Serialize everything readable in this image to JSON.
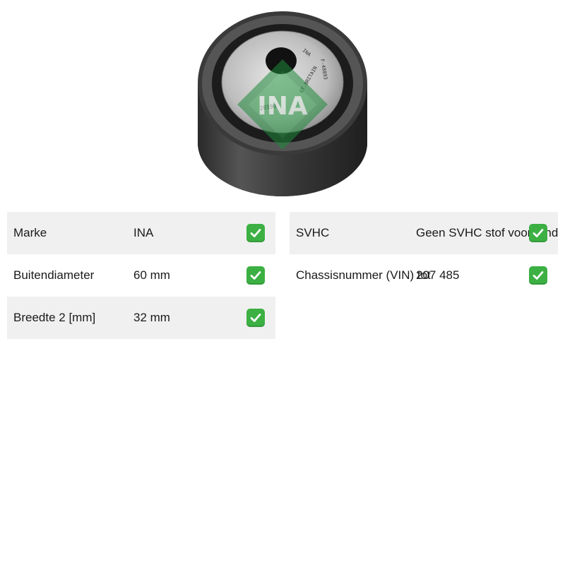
{
  "product": {
    "image_alt": "INA idler pulley",
    "image_markings": [
      "INA",
      "F-48893",
      "GT.BRITAIN",
      "20190"
    ],
    "watermark_text": "INA",
    "watermark_color": "#1f8a3a"
  },
  "specs_left": [
    {
      "label": "Marke",
      "value": "INA",
      "status": "check-icon"
    },
    {
      "label": "Buitendiameter",
      "value": "60 mm",
      "status": "check-icon"
    },
    {
      "label": "Breedte 2 [mm]",
      "value": "32 mm",
      "status": "check-icon"
    }
  ],
  "specs_right": [
    {
      "label": "SVHC",
      "value": "Geen SVHC stof voorhanden",
      "status": "check-icon"
    },
    {
      "label": "Chassisnummer (VIN) tot",
      "value": "207 485",
      "status": "check-icon"
    }
  ],
  "colors": {
    "row_shade": "#f0f0f0",
    "check_green": "#3cb043",
    "brand_green": "#1f8a3a"
  }
}
